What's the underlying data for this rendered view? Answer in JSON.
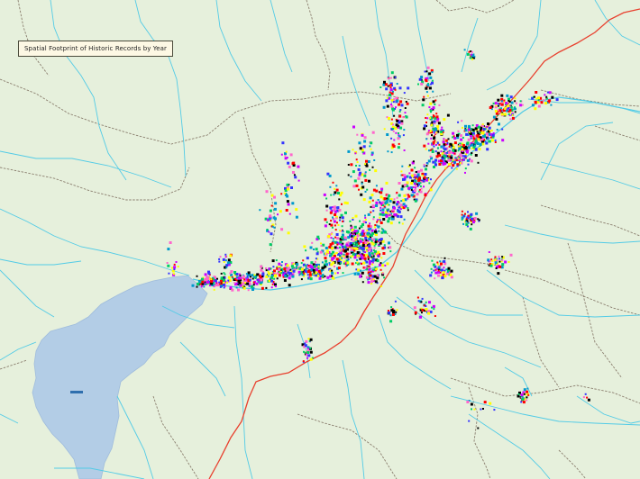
{
  "map": {
    "title": "Spatial Footprint of Historic Records by Year",
    "background_color": "#e6f0dc",
    "water_color": "#b3cde6",
    "stream_color": "#52cbe6",
    "highway_color": "#e8402e",
    "trail_color": "#8a7e6e"
  },
  "legend": {
    "record_colors": [
      "#cc00ff",
      "#000000",
      "#ff0000",
      "#ffff00",
      "#0099cc",
      "#00cc66",
      "#ff66cc",
      "#3333ff"
    ]
  }
}
